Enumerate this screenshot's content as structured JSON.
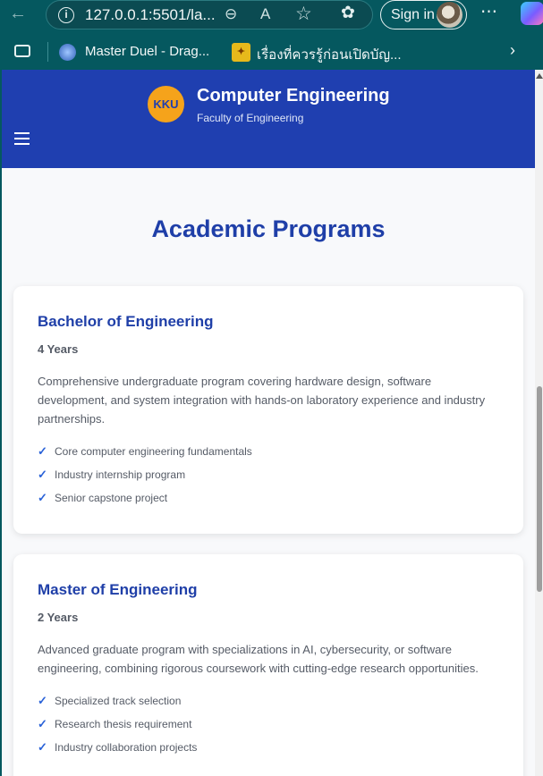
{
  "browser": {
    "url": "127.0.0.1:5501/la...",
    "signin_label": "Sign in",
    "bookmarks": [
      {
        "label": "Master Duel - Drag..."
      },
      {
        "label": "เรื่องที่ควรรู้ก่อนเปิดบัญ..."
      }
    ],
    "icons": [
      "back-arrow-icon",
      "info-icon",
      "zoom-out-icon",
      "read-aloud-icon",
      "favorite-star-icon",
      "extensions-icon",
      "more-icon",
      "copilot-icon",
      "tab-actions-icon",
      "chevron-right-icon"
    ]
  },
  "site": {
    "logo_text": "KKU",
    "title": "Computer Engineering",
    "subtitle": "Faculty of Engineering",
    "accent_color": "#1f3fb0",
    "logo_color": "#f5a31b"
  },
  "main": {
    "section_title": "Academic Programs",
    "programs": [
      {
        "title": "Bachelor of Engineering",
        "duration": "4 Years",
        "description": "Comprehensive undergraduate program covering hardware design, software development, and system integration with hands-on laboratory experience and industry partnerships.",
        "features": [
          "Core computer engineering fundamentals",
          "Industry internship program",
          "Senior capstone project"
        ]
      },
      {
        "title": "Master of Engineering",
        "duration": "2 Years",
        "description": "Advanced graduate program with specializations in AI, cybersecurity, or software engineering, combining rigorous coursework with cutting-edge research opportunities.",
        "features": [
          "Specialized track selection",
          "Research thesis requirement",
          "Industry collaboration projects"
        ]
      }
    ],
    "check_glyph": "✓"
  }
}
